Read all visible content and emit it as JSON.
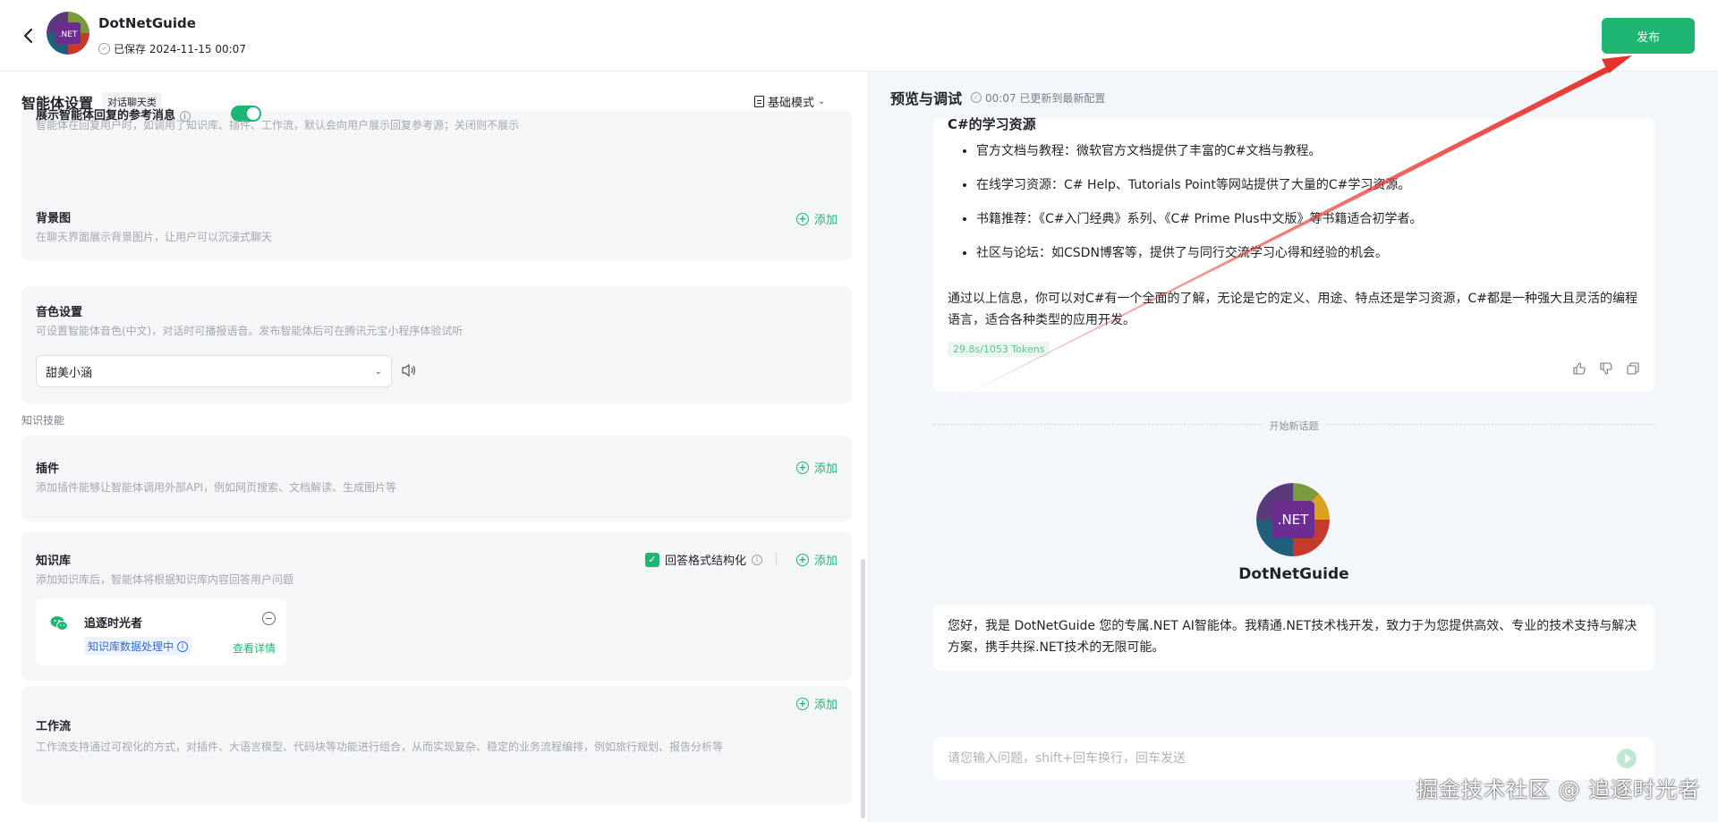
{
  "header": {
    "app_title": "DotNetGuide",
    "save_status": "已保存 2024-11-15 00:07",
    "publish_label": "发布",
    "avatar_text": ".NET"
  },
  "left": {
    "title": "智能体设置",
    "category_tag": "对话聊天类",
    "mode": "基础模式",
    "references": {
      "title": "展示智能体回复的参考消息",
      "desc": "智能体在回复用户时，如调用了知识库、插件、工作流，默认会向用户展示回复参考源；关闭则不展示",
      "enabled": true
    },
    "background": {
      "title": "背景图",
      "desc": "在聊天界面展示背景图片，让用户可以沉浸式聊天",
      "add_label": "添加"
    },
    "voice": {
      "title": "音色设置",
      "desc": "可设置智能体音色(中文)，对话时可播报语音。发布智能体后可在腾讯元宝小程序体验试听",
      "selected": "甜美小涵"
    },
    "section_knowledge": "知识技能",
    "plugins": {
      "title": "插件",
      "desc": "添加插件能够让智能体调用外部API，例如网页搜索、文档解读、生成图片等",
      "add_label": "添加"
    },
    "knowledge": {
      "title": "知识库",
      "desc": "添加知识库后，智能体将根据知识库内容回答用户问题",
      "structured_label": "回答格式结构化",
      "structured_checked": true,
      "add_label": "添加",
      "item_name": "追逐时光者",
      "item_status": "知识库数据处理中",
      "item_detail": "查看详情"
    },
    "workflow": {
      "title": "工作流",
      "desc": "工作流支持通过可视化的方式，对插件、大语言模型、代码块等功能进行组合，从而实现复杂、稳定的业务流程编排，例如旅行规划、报告分析等",
      "add_label": "添加"
    }
  },
  "right": {
    "title": "预览与调试",
    "status": "00:07 已更新到最新配置",
    "answer": {
      "heading": "C#的学习资源",
      "items": [
        "官方文档与教程：微软官方文档提供了丰富的C#文档与教程。",
        "在线学习资源：C# Help、Tutorials Point等网站提供了大量的C#学习资源。",
        "书籍推荐：《C#入门经典》系列、《C# Prime Plus中文版》等书籍适合初学者。",
        "社区与论坛：如CSDN博客等，提供了与同行交流学习心得和经验的机会。"
      ],
      "summary": "通过以上信息，你可以对C#有一个全面的了解，无论是它的定义、用途、特点还是学习资源，C#都是一种强大且灵活的编程语言，适合各种类型的应用开发。",
      "tokens": "29.8s/1053 Tokens"
    },
    "new_topic": "开始新话题",
    "bot_name": "DotNetGuide",
    "welcome": "您好，我是 DotNetGuide 您的专属.NET AI智能体。我精通.NET技术栈开发，致力于为您提供高效、专业的技术支持与解决方案，携手共探.NET技术的无限可能。",
    "input_placeholder": "请您输入问题，shift+回车换行，回车发送"
  },
  "watermark": "掘金技术社区 @ 追逐时光者",
  "colors": {
    "accent": "#1fb572",
    "annotation_arrow": "#e8312a"
  }
}
